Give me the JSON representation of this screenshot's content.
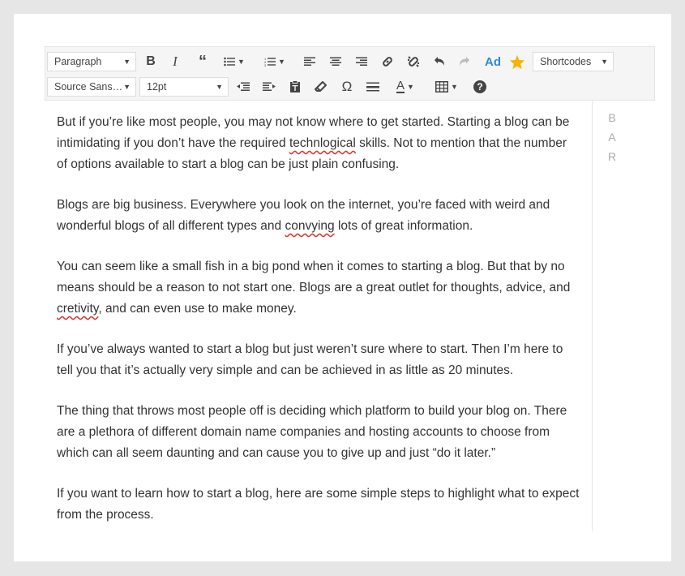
{
  "toolbar": {
    "format_select": "Paragraph",
    "font_family_select": "Source Sans…",
    "font_size_select": "12pt",
    "shortcodes_select": "Shortcodes",
    "ad_label": "Ad",
    "omega_label": "Ω",
    "text_color_label": "A",
    "help_label": "?",
    "accent_color": "#f5b400",
    "ad_color": "#2a8ad8",
    "icons": [
      "bold-icon",
      "italic-icon",
      "blockquote-icon",
      "bullet-list-icon",
      "numbered-list-icon",
      "align-left-icon",
      "align-center-icon",
      "align-right-icon",
      "link-icon",
      "unlink-icon",
      "undo-icon",
      "redo-icon",
      "ad-icon",
      "star-icon",
      "outdent-icon",
      "indent-icon",
      "paste-text-icon",
      "eraser-icon",
      "omega-icon",
      "horizontal-rule-icon",
      "text-color-icon",
      "table-icon",
      "help-icon"
    ]
  },
  "content": {
    "paragraphs": [
      {
        "pre": "But if you’re like most people, you may not know where to get started. Starting a blog can be intimidating if you don’t have the required ",
        "err": "technlogical",
        "post": " skills. Not to mention that the number of options available to start a blog can be just plain confusing."
      },
      {
        "pre": "Blogs are big business. Everywhere you look on the internet, you’re faced with weird and wonderful blogs of all different types and ",
        "err": "convying",
        "post": " lots of great information."
      },
      {
        "pre": "You can seem like a small fish in a big pond when it comes to starting a blog. But that by no means should be a reason to not start one. Blogs are a great outlet for thoughts, advice, and ",
        "err": "cretivity",
        "post": ", and can even use to make money."
      },
      {
        "pre": "If you’ve always wanted to start a blog but just weren’t sure where to start. Then I’m here to tell you that it’s actually very simple and can be achieved in as little as 20 minutes.",
        "err": "",
        "post": ""
      },
      {
        "pre": "The thing that throws most people off is deciding which platform to build your blog on. There are a plethora of different domain name companies and hosting accounts to choose from which can all seem daunting and can cause you to give up and just “do it later.”",
        "err": "",
        "post": ""
      },
      {
        "pre": "If you want to learn how to start a blog, here are some simple steps to highlight what to expect from the process.",
        "err": "",
        "post": ""
      }
    ]
  },
  "sidebar": {
    "letters": [
      "B",
      "A",
      "R"
    ]
  }
}
